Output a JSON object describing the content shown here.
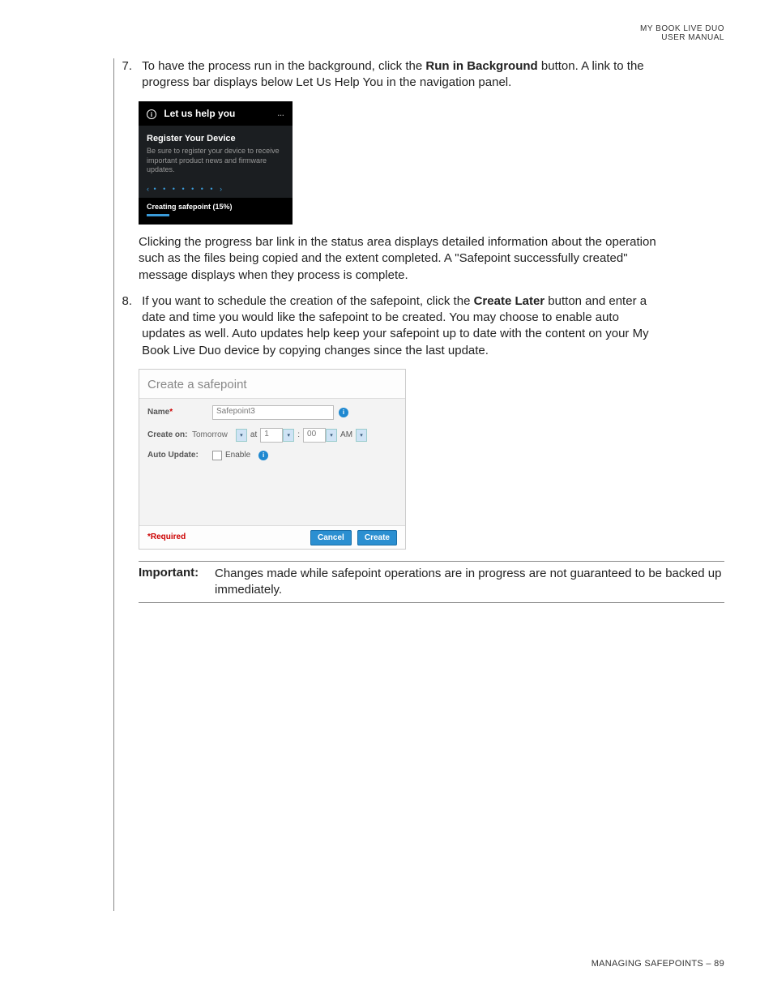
{
  "header": {
    "line1": "MY BOOK LIVE DUO",
    "line2": "USER MANUAL"
  },
  "step7": {
    "num": "7.",
    "text_a": "To have the process run in the background, click the ",
    "bold": "Run in Background",
    "text_b": " button. A link to the progress bar displays below Let Us Help You in the navigation panel."
  },
  "dark_panel": {
    "header": "Let us help you",
    "header_icon_label": "…",
    "title": "Register Your Device",
    "text": "Be sure to register your device to receive important product news and firmware updates.",
    "status": "Creating safepoint (15%)"
  },
  "after_dark_text": "Clicking the progress bar link in the status area displays detailed information about the operation such as the files being copied and the extent completed. A \"Safepoint successfully created\" message displays when they process is complete.",
  "step8": {
    "num": "8.",
    "text_a": "If you want to schedule the creation of the safepoint, click the ",
    "bold": "Create Later",
    "text_b": " button and enter a date and time you would like the safepoint to be created. You may choose to enable auto updates as well. Auto updates help keep your safepoint up to date with the content on your My Book Live Duo device by copying changes since the last update."
  },
  "safepoint": {
    "title": "Create a safepoint",
    "name_label": "Name",
    "name_star": "*",
    "name_value": "Safepoint3",
    "createon_label": "Create on:",
    "createon_value": "Tomorrow",
    "at": "at",
    "hour": "1",
    "colon": ":",
    "minute": "00",
    "ampm": "AM",
    "autoupdate_label": "Auto Update:",
    "enable": "Enable",
    "required": "*Required",
    "cancel": "Cancel",
    "create": "Create"
  },
  "important": {
    "label": "Important:",
    "text": "Changes made while safepoint operations are in progress are not guaranteed to be backed up immediately."
  },
  "footer": "MANAGING SAFEPOINTS – 89"
}
